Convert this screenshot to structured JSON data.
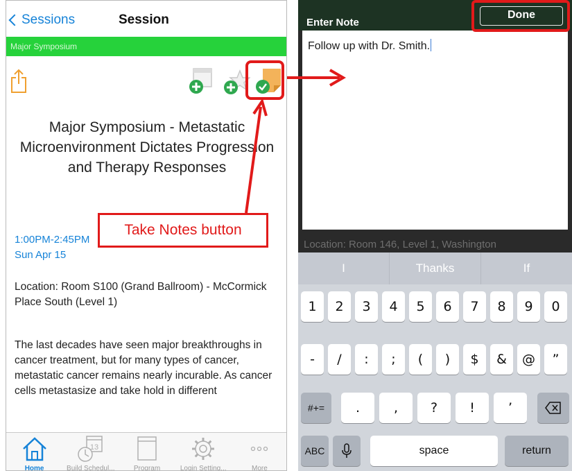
{
  "left_screen": {
    "nav": {
      "back_label": "Sessions",
      "title": "Session"
    },
    "category_bar": "Major Symposium",
    "headline": "Major Symposium - Metastatic Microenvironment Dictates Progression and Therapy Responses",
    "time": "1:00PM-2:45PM",
    "date": "Sun Apr 15",
    "location": "Location: Room S100 (Grand Ballroom) - McCormick Place South (Level 1)",
    "description": "The last decades have seen major breakthroughs in cancer treatment, but for many types of cancer, metastatic cancer remains nearly incurable. As cancer cells metastasize and take hold in different",
    "calendar_day": "13",
    "tabs": [
      {
        "label": "Home",
        "icon": "home-icon"
      },
      {
        "label": "Build Schedul...",
        "icon": "calendar-clock-icon"
      },
      {
        "label": "Program",
        "icon": "book-icon"
      },
      {
        "label": "Login Setting...",
        "icon": "gear-icon"
      },
      {
        "label": "More",
        "icon": "more-icon"
      }
    ]
  },
  "annotation": {
    "callout": "Take Notes button"
  },
  "right_screen": {
    "header_title": "Enter Note",
    "done_label": "Done",
    "note_text": "Follow up with Dr. Smith.",
    "background_text": "Location: Room 146, Level 1, Washington",
    "predictions": [
      "I",
      "Thanks",
      "If"
    ],
    "keyboard": {
      "row1": [
        "1",
        "2",
        "3",
        "4",
        "5",
        "6",
        "7",
        "8",
        "9",
        "0"
      ],
      "row2": [
        "-",
        "/",
        ":",
        ";",
        "(",
        ")",
        "$",
        "&",
        "@",
        "”"
      ],
      "row3_left": "#+=",
      "row3_mid": [
        ".",
        ",",
        "?",
        "!",
        "’"
      ],
      "abc": "ABC",
      "space": "space",
      "return": "return"
    }
  },
  "colors": {
    "accent": "#1683d8",
    "green_bar": "#26d23b",
    "highlight": "#e11a1a"
  }
}
